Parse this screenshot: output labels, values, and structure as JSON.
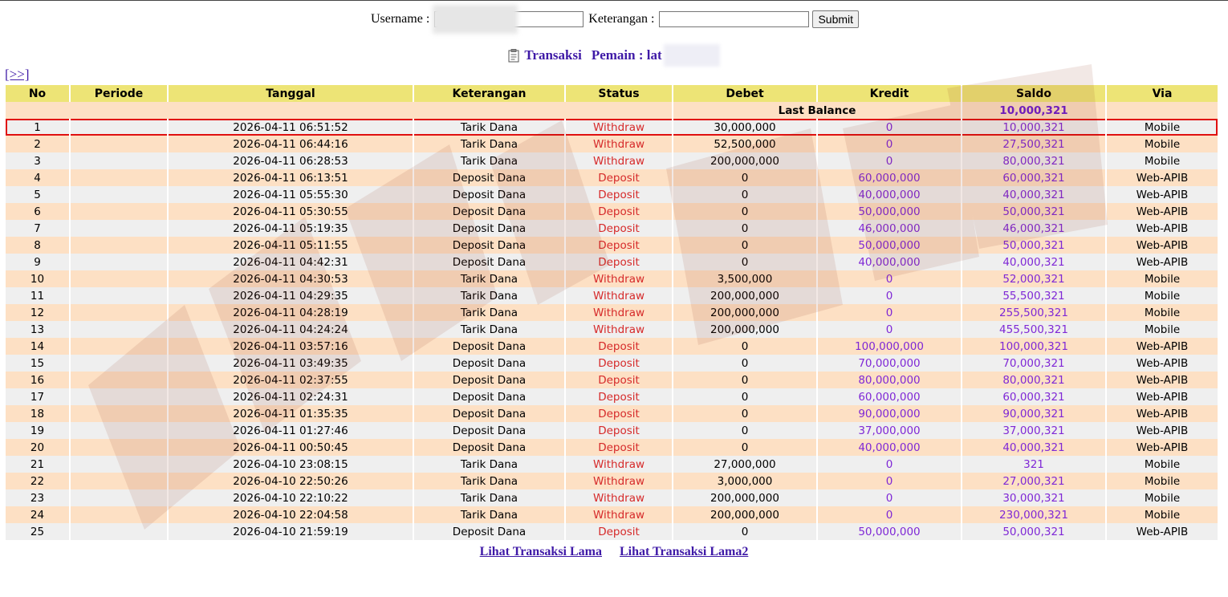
{
  "search": {
    "username_label": "Username :",
    "keterangan_label": "Keterangan :",
    "username_value": "",
    "keterangan_value": "",
    "submit_label": "Submit"
  },
  "heading": {
    "transaksi_label": "Transaksi",
    "pemain_label": "Pemain : lat"
  },
  "nav": {
    "next_label": "[>>]"
  },
  "table": {
    "headers": [
      "No",
      "Periode",
      "Tanggal",
      "Keterangan",
      "Status",
      "Debet",
      "Kredit",
      "Saldo",
      "Via"
    ],
    "last_balance_label": "Last Balance",
    "last_balance_value": "10,000,321",
    "highlight_row": 1,
    "rows": [
      [
        "1",
        "",
        "2026-04-11 06:51:52",
        "Tarik Dana",
        "Withdraw",
        "30,000,000",
        "0",
        "10,000,321",
        "Mobile"
      ],
      [
        "2",
        "",
        "2026-04-11 06:44:16",
        "Tarik Dana",
        "Withdraw",
        "52,500,000",
        "0",
        "27,500,321",
        "Mobile"
      ],
      [
        "3",
        "",
        "2026-04-11 06:28:53",
        "Tarik Dana",
        "Withdraw",
        "200,000,000",
        "0",
        "80,000,321",
        "Mobile"
      ],
      [
        "4",
        "",
        "2026-04-11 06:13:51",
        "Deposit Dana",
        "Deposit",
        "0",
        "60,000,000",
        "60,000,321",
        "Web-APIB"
      ],
      [
        "5",
        "",
        "2026-04-11 05:55:30",
        "Deposit Dana",
        "Deposit",
        "0",
        "40,000,000",
        "40,000,321",
        "Web-APIB"
      ],
      [
        "6",
        "",
        "2026-04-11 05:30:55",
        "Deposit Dana",
        "Deposit",
        "0",
        "50,000,000",
        "50,000,321",
        "Web-APIB"
      ],
      [
        "7",
        "",
        "2026-04-11 05:19:35",
        "Deposit Dana",
        "Deposit",
        "0",
        "46,000,000",
        "46,000,321",
        "Web-APIB"
      ],
      [
        "8",
        "",
        "2026-04-11 05:11:55",
        "Deposit Dana",
        "Deposit",
        "0",
        "50,000,000",
        "50,000,321",
        "Web-APIB"
      ],
      [
        "9",
        "",
        "2026-04-11 04:42:31",
        "Deposit Dana",
        "Deposit",
        "0",
        "40,000,000",
        "40,000,321",
        "Web-APIB"
      ],
      [
        "10",
        "",
        "2026-04-11 04:30:53",
        "Tarik Dana",
        "Withdraw",
        "3,500,000",
        "0",
        "52,000,321",
        "Mobile"
      ],
      [
        "11",
        "",
        "2026-04-11 04:29:35",
        "Tarik Dana",
        "Withdraw",
        "200,000,000",
        "0",
        "55,500,321",
        "Mobile"
      ],
      [
        "12",
        "",
        "2026-04-11 04:28:19",
        "Tarik Dana",
        "Withdraw",
        "200,000,000",
        "0",
        "255,500,321",
        "Mobile"
      ],
      [
        "13",
        "",
        "2026-04-11 04:24:24",
        "Tarik Dana",
        "Withdraw",
        "200,000,000",
        "0",
        "455,500,321",
        "Mobile"
      ],
      [
        "14",
        "",
        "2026-04-11 03:57:16",
        "Deposit Dana",
        "Deposit",
        "0",
        "100,000,000",
        "100,000,321",
        "Web-APIB"
      ],
      [
        "15",
        "",
        "2026-04-11 03:49:35",
        "Deposit Dana",
        "Deposit",
        "0",
        "70,000,000",
        "70,000,321",
        "Web-APIB"
      ],
      [
        "16",
        "",
        "2026-04-11 02:37:55",
        "Deposit Dana",
        "Deposit",
        "0",
        "80,000,000",
        "80,000,321",
        "Web-APIB"
      ],
      [
        "17",
        "",
        "2026-04-11 02:24:31",
        "Deposit Dana",
        "Deposit",
        "0",
        "60,000,000",
        "60,000,321",
        "Web-APIB"
      ],
      [
        "18",
        "",
        "2026-04-11 01:35:35",
        "Deposit Dana",
        "Deposit",
        "0",
        "90,000,000",
        "90,000,321",
        "Web-APIB"
      ],
      [
        "19",
        "",
        "2026-04-11 01:27:46",
        "Deposit Dana",
        "Deposit",
        "0",
        "37,000,000",
        "37,000,321",
        "Web-APIB"
      ],
      [
        "20",
        "",
        "2026-04-11 00:50:45",
        "Deposit Dana",
        "Deposit",
        "0",
        "40,000,000",
        "40,000,321",
        "Web-APIB"
      ],
      [
        "21",
        "",
        "2026-04-10 23:08:15",
        "Tarik Dana",
        "Withdraw",
        "27,000,000",
        "0",
        "321",
        "Mobile"
      ],
      [
        "22",
        "",
        "2026-04-10 22:50:26",
        "Tarik Dana",
        "Withdraw",
        "3,000,000",
        "0",
        "27,000,321",
        "Mobile"
      ],
      [
        "23",
        "",
        "2026-04-10 22:10:22",
        "Tarik Dana",
        "Withdraw",
        "200,000,000",
        "0",
        "30,000,321",
        "Mobile"
      ],
      [
        "24",
        "",
        "2026-04-10 22:04:58",
        "Tarik Dana",
        "Withdraw",
        "200,000,000",
        "0",
        "230,000,321",
        "Mobile"
      ],
      [
        "25",
        "",
        "2026-04-10 21:59:19",
        "Deposit Dana",
        "Deposit",
        "0",
        "50,000,000",
        "50,000,321",
        "Web-APIB"
      ]
    ]
  },
  "footer": {
    "link1": "Lihat Transaksi Lama",
    "link2": "Lihat Transaksi Lama2"
  },
  "colors": {
    "header_bg": "#ede476",
    "row_odd": "#fde0c4",
    "row_even": "#efefef",
    "status_red": "#d62a2a",
    "amount_purple": "#7f28d6",
    "link_purple": "#3f1aa7",
    "highlight_border": "#e01010"
  }
}
